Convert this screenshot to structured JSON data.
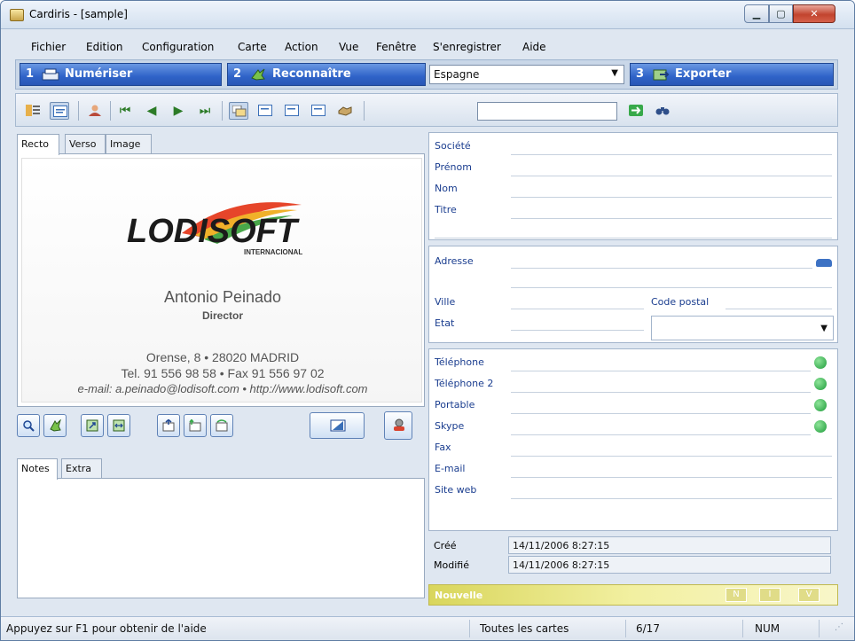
{
  "window": {
    "title": "Cardiris - [sample]"
  },
  "menu": [
    "Fichier",
    "Edition",
    "Configuration",
    "Carte",
    "Action",
    "Vue",
    "Fenêtre",
    "S'enregistrer",
    "Aide"
  ],
  "steps": [
    {
      "num": "1",
      "label": "Numériser",
      "icon": "scanner-icon"
    },
    {
      "num": "2",
      "label": "Reconnaître",
      "icon": "puzzle-icon"
    },
    {
      "num": "3",
      "label": "Exporter",
      "icon": "export-icon"
    }
  ],
  "country_select": {
    "value": "Espagne"
  },
  "search": {
    "value": ""
  },
  "card_tabs": [
    "Recto",
    "Verso",
    "Image"
  ],
  "notes_tabs": [
    "Notes",
    "Extra"
  ],
  "card": {
    "logo_text": "LODISOFT",
    "logo_sub": "INTERNACIONAL",
    "name": "Antonio Peinado",
    "title": "Director",
    "address": "Orense, 8 • 28020 MADRID",
    "phones": "Tel. 91 556 98 58 • Fax 91 556 97 02",
    "web": "e-mail: a.peinado@lodisoft.com • http://www.lodisoft.com"
  },
  "fields": {
    "company": "Société",
    "firstname": "Prénom",
    "lastname": "Nom",
    "jobtitle": "Titre",
    "address": "Adresse",
    "city": "Ville",
    "zip": "Code postal",
    "state": "Etat",
    "phone": "Téléphone",
    "phone2": "Téléphone 2",
    "mobile": "Portable",
    "skype": "Skype",
    "fax": "Fax",
    "email": "E-mail",
    "website": "Site web",
    "created": "Créé",
    "modified": "Modifié"
  },
  "dates": {
    "created": "14/11/2006 8:27:15",
    "modified": "14/11/2006 8:27:15"
  },
  "card_state": {
    "label": "Nouvelle",
    "buttons": [
      "N",
      "I",
      "V"
    ]
  },
  "status": {
    "help": "Appuyez sur F1 pour obtenir de l'aide",
    "filter": "Toutes les cartes",
    "position": "6/17",
    "num": "NUM"
  },
  "colors": {
    "accent": "#2f63c8",
    "label_blue": "#1a3d8f",
    "phone_green": "#1e9b3a",
    "state_yellow": "#d9d65c"
  }
}
